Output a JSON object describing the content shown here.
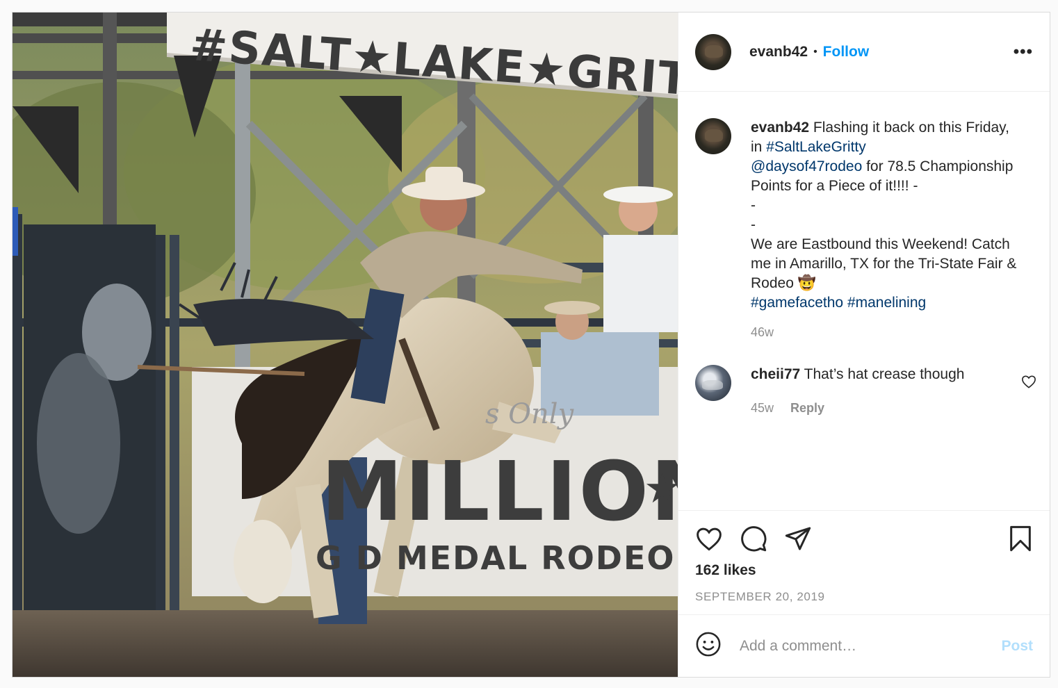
{
  "photo": {
    "sign_text": "#SALT★LAKE★GRITTY",
    "banner_script": "s Only",
    "banner_big": "MILLION",
    "banner_small": "G D MEDAL RODEO"
  },
  "post": {
    "username": "evanb42",
    "separator": "•",
    "follow_label": "Follow",
    "more_label": "•••",
    "caption": {
      "username": "evanb42",
      "text_1": " Flashing it back on this Friday, in ",
      "hashtag_1": "#SaltLakeGritty",
      "mention": "@daysof47rodeo",
      "text_2": " for 78.5 Championship Points for a Piece of it!!!! -\n-\n-\nWe are Eastbound this Weekend! Catch me in Amarillo, TX for the Tri-State Fair & Rodeo 🤠",
      "hashtag_2": "#gamefacetho",
      "hashtag_3": "#manelining",
      "age": "46w"
    },
    "comments": [
      {
        "username": "cheii77",
        "text": " That’s hat crease though",
        "age": "45w",
        "reply_label": "Reply"
      }
    ],
    "likes": "162 likes",
    "date": "SEPTEMBER 20, 2019",
    "add_comment_placeholder": "Add a comment…",
    "post_label": "Post"
  },
  "colors": {
    "link_blue": "#0095f6",
    "hashtag": "#00376b",
    "muted": "#8e8e8e",
    "post_disabled": "#b2dffc"
  }
}
